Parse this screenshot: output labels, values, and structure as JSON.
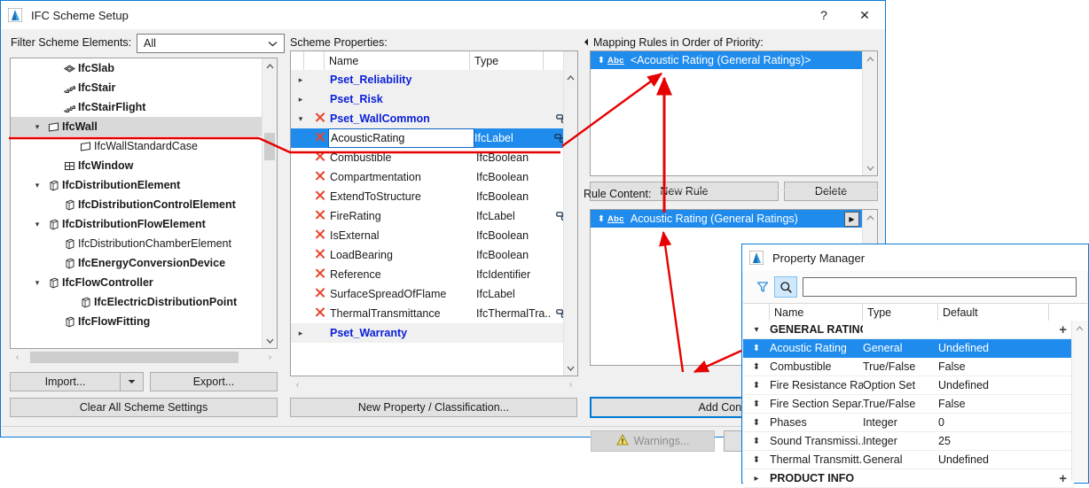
{
  "main_window": {
    "title": "IFC Scheme Setup",
    "help_label": "?",
    "close_label": "✕",
    "filter_label": "Filter Scheme Elements:",
    "filter_value": "All",
    "scheme_properties_label": "Scheme Properties:",
    "mapping_rules_label": "Mapping Rules in Order of Priority:",
    "rule_content_label": "Rule Content:",
    "buttons": {
      "import": "Import...",
      "export": "Export...",
      "clear_all": "Clear All Scheme Settings",
      "new_property": "New Property / Classification...",
      "new_rule": "New Rule",
      "delete": "Delete",
      "add_content": "Add Content...",
      "warnings": "Warnings..."
    }
  },
  "tree": {
    "items": [
      {
        "label": "IfcSlab",
        "indent": 2,
        "icon": "slab-icon",
        "expander": "",
        "selected": false,
        "bold": true
      },
      {
        "label": "IfcStair",
        "indent": 2,
        "icon": "stair-icon",
        "expander": "",
        "selected": false,
        "bold": true
      },
      {
        "label": "IfcStairFlight",
        "indent": 2,
        "icon": "stair-icon",
        "expander": "",
        "selected": false,
        "bold": true
      },
      {
        "label": "IfcWall",
        "indent": 1,
        "icon": "wall-icon",
        "expander": "▾",
        "selected": true,
        "bold": true
      },
      {
        "label": "IfcWallStandardCase",
        "indent": 3,
        "icon": "wall-icon",
        "expander": "",
        "selected": false,
        "bold": false
      },
      {
        "label": "IfcWindow",
        "indent": 2,
        "icon": "window-icon",
        "expander": "",
        "selected": false,
        "bold": true
      },
      {
        "label": "IfcDistributionElement",
        "indent": 1,
        "icon": "box-icon",
        "expander": "▾",
        "selected": false,
        "bold": true
      },
      {
        "label": "IfcDistributionControlElement",
        "indent": 2,
        "icon": "box-icon",
        "expander": "",
        "selected": false,
        "bold": true
      },
      {
        "label": "IfcDistributionFlowElement",
        "indent": 1,
        "icon": "box-icon",
        "expander": "▾",
        "selected": false,
        "bold": true
      },
      {
        "label": "IfcDistributionChamberElement",
        "indent": 2,
        "icon": "box-icon",
        "expander": "",
        "selected": false,
        "bold": false
      },
      {
        "label": "IfcEnergyConversionDevice",
        "indent": 2,
        "icon": "box-icon",
        "expander": "",
        "selected": false,
        "bold": true
      },
      {
        "label": "IfcFlowController",
        "indent": 1,
        "icon": "box-icon",
        "expander": "▾",
        "selected": false,
        "bold": true
      },
      {
        "label": "IfcElectricDistributionPoint",
        "indent": 3,
        "icon": "box-icon",
        "expander": "",
        "selected": false,
        "bold": true
      },
      {
        "label": "IfcFlowFitting",
        "indent": 2,
        "icon": "box-icon",
        "expander": "",
        "selected": false,
        "bold": true
      }
    ]
  },
  "properties_grid": {
    "columns": [
      "",
      "",
      "Name",
      "Type",
      ""
    ],
    "rows": [
      {
        "expander": "▸",
        "mark": false,
        "name": "Pset_Reliability",
        "type": "",
        "link": false,
        "group": true,
        "selected": false
      },
      {
        "expander": "▸",
        "mark": false,
        "name": "Pset_Risk",
        "type": "",
        "link": false,
        "group": true,
        "selected": false
      },
      {
        "expander": "▾",
        "mark": true,
        "name": "Pset_WallCommon",
        "type": "",
        "link": true,
        "group": true,
        "selected": false
      },
      {
        "expander": "",
        "mark": true,
        "name": "AcousticRating",
        "type": "IfcLabel",
        "link": true,
        "group": false,
        "selected": true
      },
      {
        "expander": "",
        "mark": true,
        "name": "Combustible",
        "type": "IfcBoolean",
        "link": false,
        "group": false,
        "selected": false
      },
      {
        "expander": "",
        "mark": true,
        "name": "Compartmentation",
        "type": "IfcBoolean",
        "link": false,
        "group": false,
        "selected": false
      },
      {
        "expander": "",
        "mark": true,
        "name": "ExtendToStructure",
        "type": "IfcBoolean",
        "link": false,
        "group": false,
        "selected": false
      },
      {
        "expander": "",
        "mark": true,
        "name": "FireRating",
        "type": "IfcLabel",
        "link": true,
        "group": false,
        "selected": false
      },
      {
        "expander": "",
        "mark": true,
        "name": "IsExternal",
        "type": "IfcBoolean",
        "link": false,
        "group": false,
        "selected": false
      },
      {
        "expander": "",
        "mark": true,
        "name": "LoadBearing",
        "type": "IfcBoolean",
        "link": false,
        "group": false,
        "selected": false
      },
      {
        "expander": "",
        "mark": true,
        "name": "Reference",
        "type": "IfcIdentifier",
        "link": false,
        "group": false,
        "selected": false
      },
      {
        "expander": "",
        "mark": true,
        "name": "SurfaceSpreadOfFlame",
        "type": "IfcLabel",
        "link": false,
        "group": false,
        "selected": false
      },
      {
        "expander": "",
        "mark": true,
        "name": "ThermalTransmittance",
        "type": "IfcThermalTra...",
        "link": true,
        "group": false,
        "selected": false
      },
      {
        "expander": "▸",
        "mark": false,
        "name": "Pset_Warranty",
        "type": "",
        "link": false,
        "group": true,
        "selected": false
      }
    ]
  },
  "mapping_rules": {
    "items": [
      {
        "abc": "Abc",
        "label": "<Acoustic Rating (General Ratings)>"
      }
    ]
  },
  "rule_content": {
    "items": [
      {
        "abc": "Abc",
        "label": "Acoustic Rating (General Ratings)"
      }
    ]
  },
  "property_manager": {
    "title": "Property Manager",
    "search_value": "",
    "columns": [
      "",
      "Name",
      "Type",
      "Default"
    ],
    "rows": [
      {
        "kind": "category",
        "name": "GENERAL RATINGS",
        "type": "",
        "default": "",
        "expander": "▾",
        "plus": "+",
        "selected": false
      },
      {
        "kind": "item",
        "name": "Acoustic Rating",
        "type": "General",
        "default": "Undefined",
        "expander": "",
        "plus": "",
        "selected": true
      },
      {
        "kind": "item",
        "name": "Combustible",
        "type": "True/False",
        "default": "False",
        "expander": "",
        "plus": "",
        "selected": false
      },
      {
        "kind": "item",
        "name": "Fire Resistance Ra...",
        "type": "Option Set",
        "default": "Undefined",
        "expander": "",
        "plus": "",
        "selected": false
      },
      {
        "kind": "item",
        "name": "Fire Section Separ...",
        "type": "True/False",
        "default": "False",
        "expander": "",
        "plus": "",
        "selected": false
      },
      {
        "kind": "item",
        "name": "Phases",
        "type": "Integer",
        "default": "0",
        "expander": "",
        "plus": "",
        "selected": false
      },
      {
        "kind": "item",
        "name": "Sound Transmissi...",
        "type": "Integer",
        "default": "25",
        "expander": "",
        "plus": "",
        "selected": false
      },
      {
        "kind": "item",
        "name": "Thermal Transmitt...",
        "type": "General",
        "default": "Undefined",
        "expander": "",
        "plus": "",
        "selected": false
      },
      {
        "kind": "category",
        "name": "PRODUCT INFO",
        "type": "",
        "default": "",
        "expander": "▸",
        "plus": "+",
        "selected": false
      }
    ]
  },
  "colors": {
    "selection_blue": "#1f8ced",
    "group_text_blue": "#0b21d8",
    "x_mark_red": "#e8442a",
    "annotation_red": "#e60000",
    "window_border": "#0a7ad6"
  }
}
